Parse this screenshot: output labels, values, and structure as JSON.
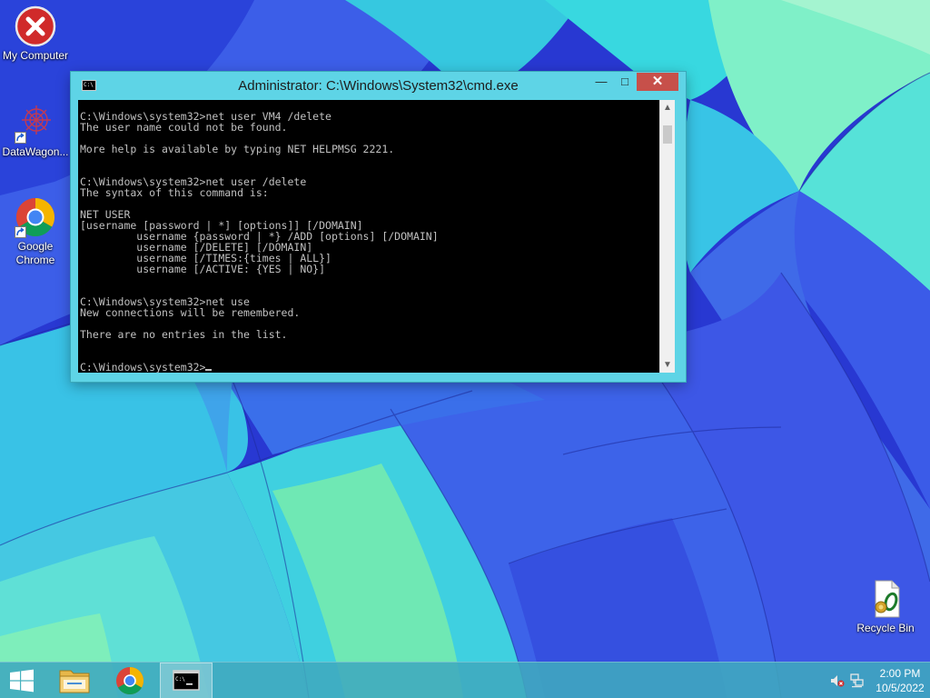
{
  "desktop": {
    "icons": [
      {
        "label": "My Computer",
        "icon": "error-x-icon"
      },
      {
        "label": "DataWagon...",
        "icon": "datawagon-icon"
      },
      {
        "label": "Google Chrome",
        "icon": "chrome-icon"
      },
      {
        "label": "Recycle Bin",
        "icon": "recycle-bin-icon"
      }
    ]
  },
  "window": {
    "title": "Administrator: C:\\Windows\\System32\\cmd.exe",
    "title_icon_text": "C:\\",
    "buttons": {
      "minimize": "—",
      "maximize": "□",
      "close": "✕"
    },
    "console_lines": [
      "C:\\Windows\\system32>net user VM4 /delete",
      "The user name could not be found.",
      "",
      "More help is available by typing NET HELPMSG 2221.",
      "",
      "",
      "C:\\Windows\\system32>net user /delete",
      "The syntax of this command is:",
      "",
      "NET USER",
      "[username [password | *] [options]] [/DOMAIN]",
      "         username {password | *} /ADD [options] [/DOMAIN]",
      "         username [/DELETE] [/DOMAIN]",
      "         username [/TIMES:{times | ALL}]",
      "         username [/ACTIVE: {YES | NO}]",
      "",
      "",
      "C:\\Windows\\system32>net use",
      "New connections will be remembered.",
      "",
      "There are no entries in the list.",
      "",
      ""
    ],
    "prompt": "C:\\Windows\\system32>",
    "scroll_arrows": {
      "up": "▲",
      "down": "▼"
    }
  },
  "taskbar": {
    "items": [
      "start-icon",
      "file-explorer-icon",
      "chrome-icon",
      "cmd-icon"
    ],
    "clock": {
      "time": "2:00 PM",
      "date": "10/5/2022"
    }
  },
  "colors": {
    "titlebar": "#5ed4e6",
    "close_button": "#c7504a",
    "console_bg": "#000000",
    "console_text": "#c0c0c0",
    "taskbar": "#40a8be"
  }
}
